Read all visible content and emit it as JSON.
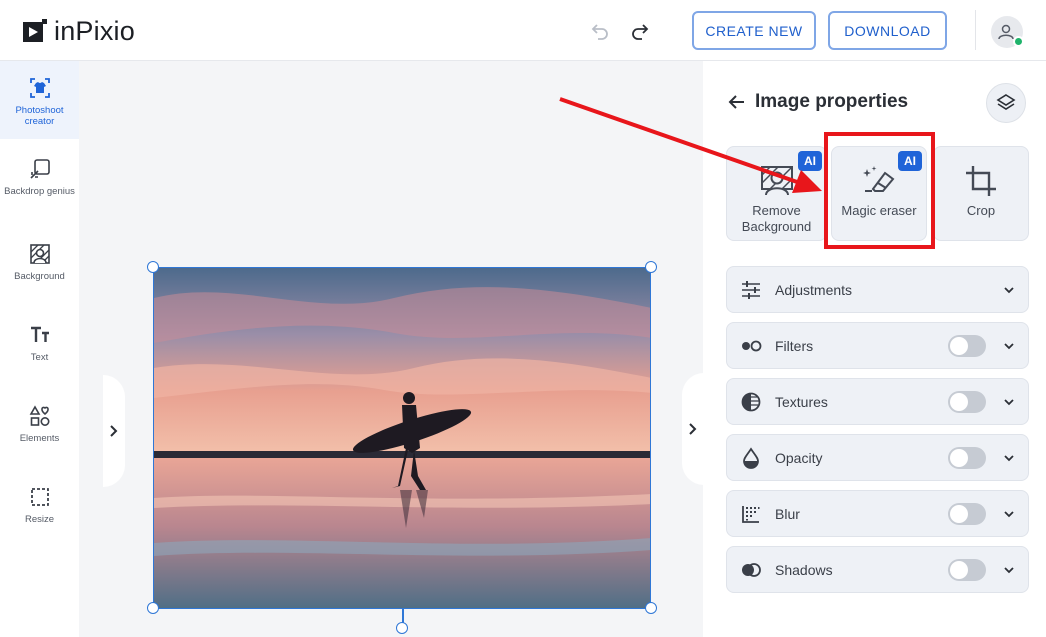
{
  "header": {
    "logo_text": "inPixio",
    "undo_icon": "undo-icon",
    "redo_icon": "redo-icon",
    "create_new_label": "CREATE NEW",
    "download_label": "DOWNLOAD",
    "avatar_icon": "user-icon",
    "status_color": "#1fb36b"
  },
  "sidebar": {
    "items": [
      {
        "label": "Photoshoot creator",
        "icon": "shirt-icon",
        "active": true
      },
      {
        "label": "Backdrop genius",
        "icon": "backdrop-icon",
        "active": false
      },
      {
        "label": "Background",
        "icon": "background-icon",
        "active": false
      },
      {
        "label": "Text",
        "icon": "text-icon",
        "active": false
      },
      {
        "label": "Elements",
        "icon": "shapes-icon",
        "active": false
      },
      {
        "label": "Resize",
        "icon": "resize-icon",
        "active": false
      }
    ]
  },
  "panel": {
    "title": "Image properties",
    "tools": [
      {
        "label": "Remove Background",
        "badge": "AI",
        "icon": "remove-background-icon"
      },
      {
        "label": "Magic eraser",
        "badge": "AI",
        "icon": "magic-eraser-icon"
      },
      {
        "label": "Crop",
        "badge": "",
        "icon": "crop-icon"
      }
    ],
    "sections": [
      {
        "label": "Adjustments",
        "icon": "sliders-icon",
        "toggle": null
      },
      {
        "label": "Filters",
        "icon": "filters-icon",
        "toggle": false
      },
      {
        "label": "Textures",
        "icon": "textures-icon",
        "toggle": false
      },
      {
        "label": "Opacity",
        "icon": "opacity-icon",
        "toggle": false
      },
      {
        "label": "Blur",
        "icon": "blur-icon",
        "toggle": false
      },
      {
        "label": "Shadows",
        "icon": "shadows-icon",
        "toggle": false
      }
    ]
  },
  "colors": {
    "accent": "#1f64d8",
    "annotation": "#e8161b"
  }
}
